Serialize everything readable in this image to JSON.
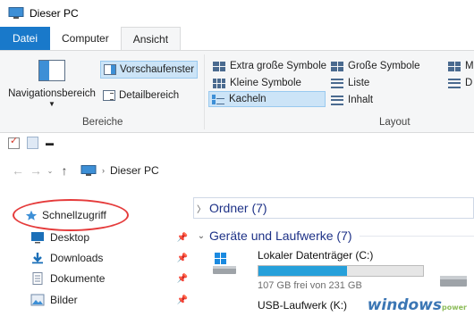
{
  "window": {
    "title": "Dieser PC"
  },
  "tabs": [
    {
      "label": "Datei"
    },
    {
      "label": "Computer"
    },
    {
      "label": "Ansicht"
    }
  ],
  "ribbon": {
    "bereiche": {
      "navigation_pane": "Navigationsbereich",
      "preview_pane": "Vorschaufenster",
      "details_pane": "Detailbereich",
      "group_label": "Bereiche"
    },
    "layout": {
      "items": [
        "Extra große Symbole",
        "Große Symbole",
        "Kleine Symbole",
        "Liste",
        "Kacheln",
        "Inhalt"
      ],
      "cut_items": [
        "M",
        "D"
      ],
      "selected": "Kacheln",
      "group_label": "Layout"
    }
  },
  "address": {
    "crumb": "Dieser PC"
  },
  "nav": {
    "quick_access": "Schnellzugriff",
    "items": [
      "Desktop",
      "Downloads",
      "Dokumente",
      "Bilder"
    ]
  },
  "content": {
    "folders_header": "Ordner (7)",
    "devices_header": "Geräte und Laufwerke (7)",
    "drives": [
      {
        "name": "Lokaler Datenträger (C:)",
        "free": "107 GB frei von 231 GB",
        "used_fraction": 0.54
      },
      {
        "name": "USB-Laufwerk (K:)"
      }
    ]
  },
  "watermark": {
    "text": "windows",
    "suffix": "power"
  },
  "colors": {
    "accent": "#1979ca",
    "highlight": "#e53b3b",
    "selected": "#cce4f7",
    "drive_fill": "#26a0da"
  }
}
